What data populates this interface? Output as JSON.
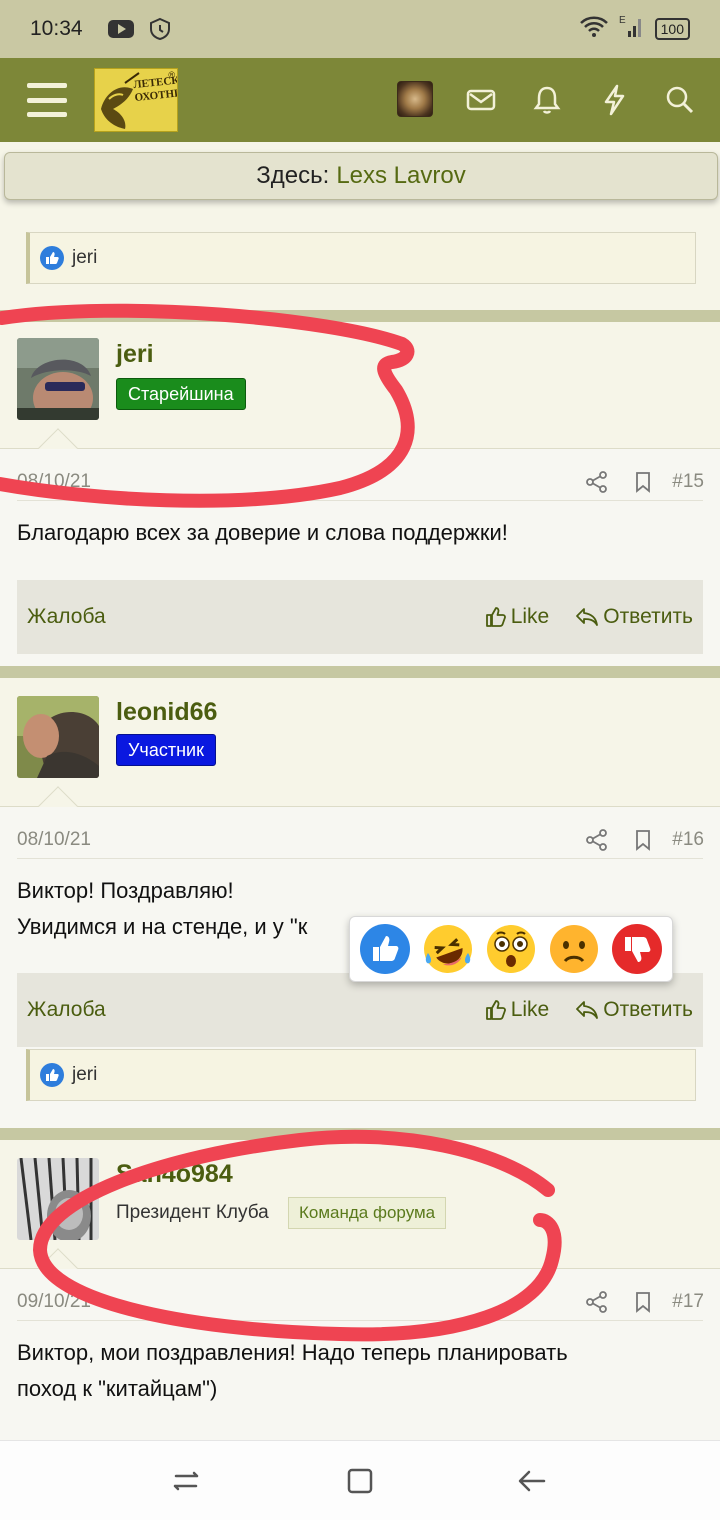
{
  "status_bar": {
    "time": "10:34",
    "battery": "100",
    "network": "E"
  },
  "header": {
    "logo_text": "ЛЕТЕСКИЙ ОХОТНИК",
    "icons": [
      "menu-icon",
      "mail-icon",
      "bell-icon",
      "lightning-icon",
      "search-icon"
    ]
  },
  "here_bar": {
    "label": "Здесь:",
    "user": "Lexs Lavrov"
  },
  "prev_post": {
    "reaction_user": "jeri"
  },
  "posts": [
    {
      "username": "jeri",
      "badge": "Старейшина",
      "badge_color": "#1a8c1c",
      "date": "08/10/21",
      "number": "#15",
      "message": [
        "Благодарю всех за доверие и слова поддержки!"
      ],
      "report": "Жалоба",
      "like": "Like",
      "reply": "Ответить"
    },
    {
      "username": "leonid66",
      "badge": "Участник",
      "badge_color": "#0a18e0",
      "date": "08/10/21",
      "number": "#16",
      "message": [
        "Виктор! Поздравляю!",
        "Увидимся и на стенде, и у \"к"
      ],
      "report": "Жалоба",
      "like": "Like",
      "reply": "Ответить",
      "reaction_user": "jeri"
    },
    {
      "username": "San4o984",
      "user_title": "Президент Клуба",
      "team_badge": "Команда форума",
      "date": "09/10/21",
      "number": "#17",
      "message": [
        "Виктор, мои поздравления! Надо теперь планировать",
        "поход к \"китайцам\")"
      ]
    }
  ],
  "reaction_popup": [
    "like",
    "haha",
    "wow",
    "sad",
    "dislike"
  ]
}
